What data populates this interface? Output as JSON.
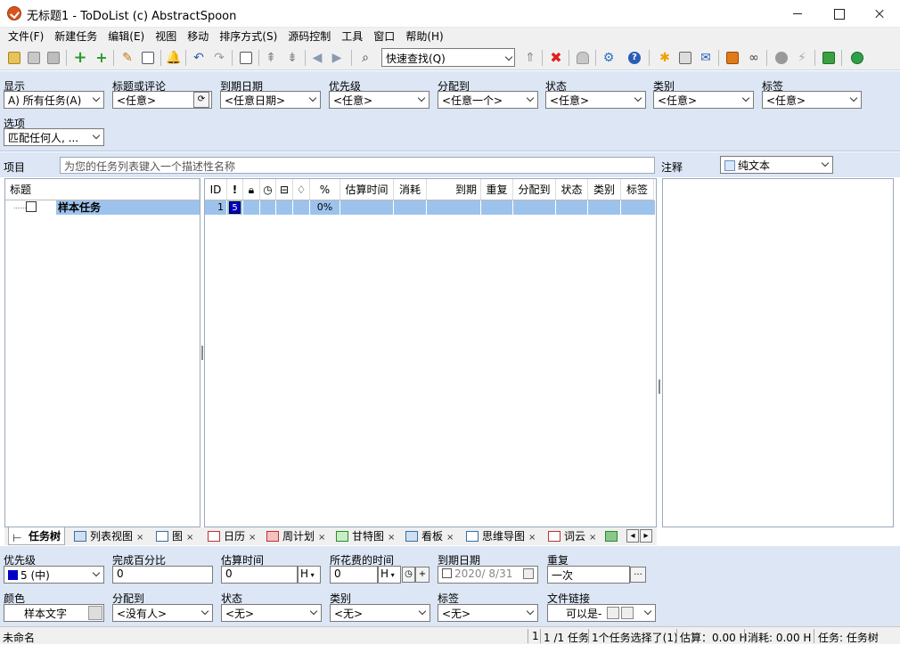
{
  "window": {
    "title": "无标题1 - ToDoList (c) AbstractSpoon"
  },
  "menu": [
    "文件(F)",
    "新建任务",
    "编辑(E)",
    "视图",
    "移动",
    "排序方式(S)",
    "源码控制",
    "工具",
    "窗口",
    "帮助(H)"
  ],
  "toolbar": {
    "quick_find_label": "快速查找(Q)"
  },
  "filters": {
    "show_label": "显示",
    "show_value": "A)  所有任务(A)",
    "title_label": "标题或评论",
    "title_value": "<任意>",
    "due_label": "到期日期",
    "due_value": "<任意日期>",
    "priority_label": "优先级",
    "priority_value": "<任意>",
    "assigned_label": "分配到",
    "assigned_value": "<任意一个>",
    "status_label": "状态",
    "status_value": "<任意>",
    "category_label": "类别",
    "category_value": "<任意>",
    "tags_label": "标签",
    "tags_value": "<任意>",
    "options_label": "选项",
    "options_value": "匹配任何人, ..."
  },
  "project": {
    "label": "项目",
    "placeholder": "为您的任务列表键入一个描述性名称"
  },
  "notes": {
    "label": "注释",
    "format_value": "纯文本"
  },
  "tree": {
    "header": "标题",
    "task_title": "样本任务"
  },
  "list": {
    "columns": [
      "ID",
      "!",
      "%",
      "估算时间",
      "消耗",
      "到期",
      "重复",
      "分配到",
      "状态",
      "类别",
      "标签"
    ],
    "row": {
      "id": "1",
      "priority": "5",
      "percent": "0%"
    }
  },
  "tabs": [
    "任务树",
    "列表视图",
    "图",
    "日历",
    "周计划",
    "甘特图",
    "看板",
    "思维导图",
    "词云"
  ],
  "attributes": {
    "priority_label": "优先级",
    "priority_value": "5 (中)",
    "percent_label": "完成百分比",
    "percent_value": "0",
    "estimate_label": "估算时间",
    "estimate_value": "0",
    "estimate_unit": "H",
    "spent_label": "所花费的时间",
    "spent_value": "0",
    "spent_unit": "H",
    "due_label": "到期日期",
    "due_value": "2020/  8/31",
    "recur_label": "重复",
    "recur_value": "一次",
    "color_label": "颜色",
    "color_value": "样本文字",
    "assigned_label": "分配到",
    "assigned_value": "<没有人>",
    "status_label": "状态",
    "status_value": "<无>",
    "category_label": "类别",
    "category_value": "<无>",
    "tags_label": "标签",
    "tags_value": "<无>",
    "filelink_label": "文件链接",
    "filelink_value": "可以是-"
  },
  "status": {
    "file": "未命名",
    "count": "1",
    "tasks": "1 /1 任务",
    "selected": "1个任务选择了(1)",
    "estimate": "估算：0.00 H",
    "spent": "消耗: 0.00 H",
    "view": "任务: 任务树"
  },
  "colors": {
    "accent": "#dce6f4",
    "selection": "#9dc3ec",
    "priority": "#0000c8"
  }
}
